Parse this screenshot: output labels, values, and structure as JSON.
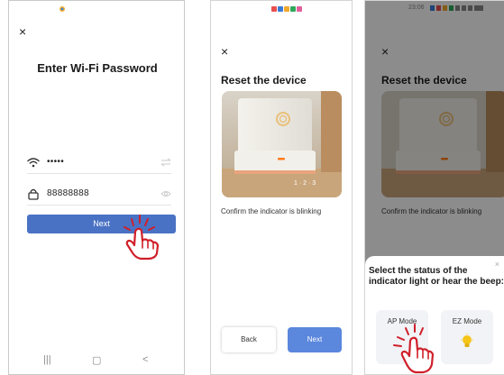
{
  "screen1": {
    "close_glyph": "×",
    "title": "Enter Wi-Fi Password",
    "wifi_field_value": "•••••",
    "password_field_value": "88888888",
    "next_label": "Next",
    "nav": {
      "recent_glyph": "|||",
      "home_glyph": "▢",
      "back_glyph": "<"
    }
  },
  "screen2": {
    "close_glyph": "×",
    "title": "Reset the device",
    "carousel_label": "1 · 2 · 3",
    "caption": "Confirm the indicator is blinking",
    "back_label": "Back",
    "next_label": "Next"
  },
  "screen3": {
    "status_time": "23:06",
    "close_glyph": "×",
    "title": "Reset the device",
    "caption": "Confirm the indicator is blinking",
    "sheet": {
      "close_glyph": "×",
      "question": "Select the status of the indicator light or hear the beep:",
      "modes": [
        {
          "label": "AP Mode"
        },
        {
          "label": "EZ Mode"
        }
      ]
    }
  },
  "colors": {
    "primary_button": "#4a72c4",
    "next_button": "#5b87dd",
    "tap_hand": "#d01f2a",
    "led": "#ff7a1a",
    "bulb": "#f5c518"
  },
  "icons": [
    "wifi-icon",
    "lock-icon",
    "eye-icon",
    "close-icon",
    "tap-hand-icon",
    "bulb-icon"
  ]
}
